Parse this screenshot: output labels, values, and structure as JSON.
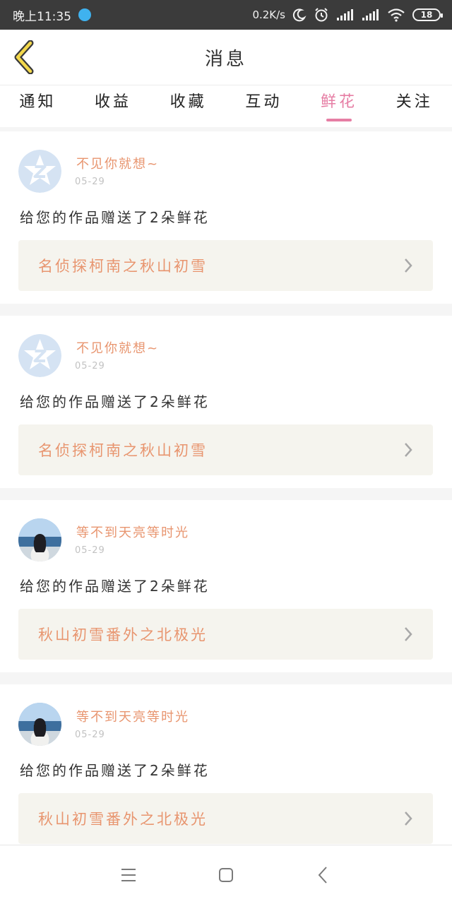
{
  "status_bar": {
    "time": "晚上11:35",
    "network_speed": "0.2K/s",
    "battery": "18"
  },
  "header": {
    "title": "消息"
  },
  "tabs": [
    {
      "label": "通知"
    },
    {
      "label": "收益"
    },
    {
      "label": "收藏"
    },
    {
      "label": "互动"
    },
    {
      "label": "鲜花"
    },
    {
      "label": "关注"
    }
  ],
  "active_tab": "鲜花",
  "messages": [
    {
      "sender": "不见你就想~",
      "date": "05-29",
      "text": "给您的作品赠送了2朵鲜花",
      "work": "名侦探柯南之秋山初雪",
      "avatar": "default-avatar"
    },
    {
      "sender": "不见你就想~",
      "date": "05-29",
      "text": "给您的作品赠送了2朵鲜花",
      "work": "名侦探柯南之秋山初雪",
      "avatar": "default-avatar"
    },
    {
      "sender": "等不到天亮等时光",
      "date": "05-29",
      "text": "给您的作品赠送了2朵鲜花",
      "work": "秋山初雪番外之北极光",
      "avatar": "photo-avatar"
    },
    {
      "sender": "等不到天亮等时光",
      "date": "05-29",
      "text": "给您的作品赠送了2朵鲜花",
      "work": "秋山初雪番外之北极光",
      "avatar": "photo-avatar"
    }
  ],
  "colors": {
    "accent_pink": "#e67ea4",
    "orange_text": "#e8956f",
    "link_bg": "#f5f4ee",
    "status_bar_bg": "#3b3b3b",
    "back_arrow": "#f3d84c"
  }
}
